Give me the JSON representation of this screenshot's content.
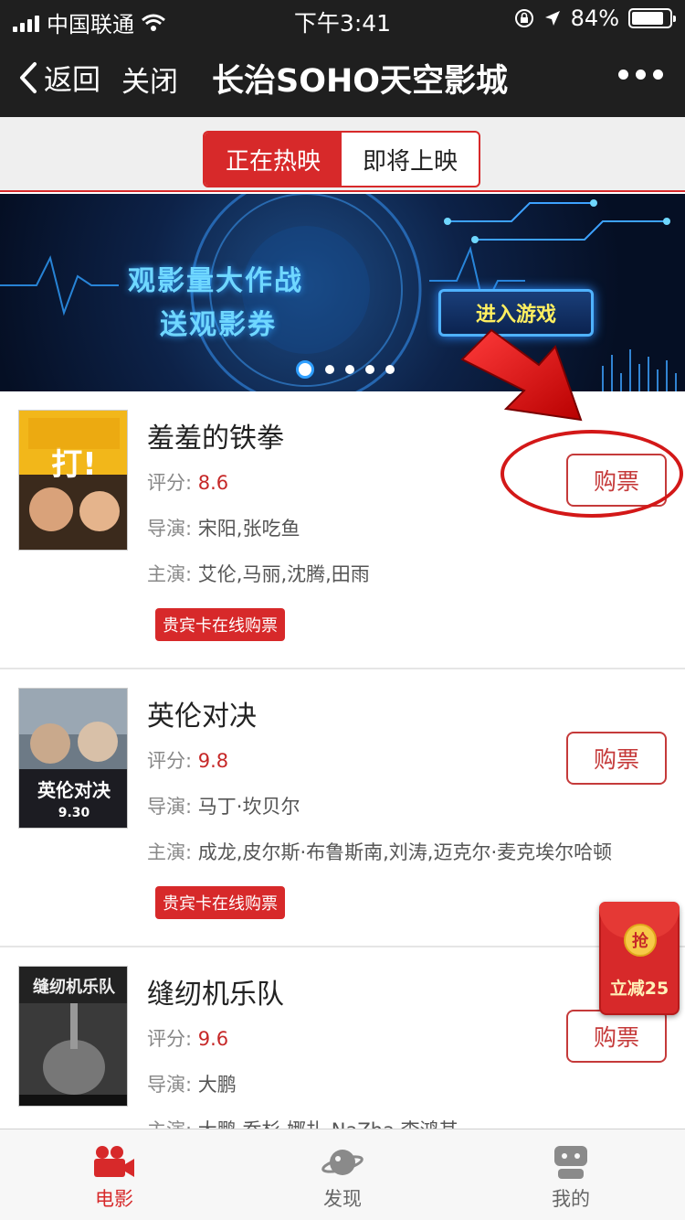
{
  "status_bar": {
    "carrier": "中国联通",
    "time": "下午3:41",
    "battery": "84%",
    "battery_level": 0.84
  },
  "nav": {
    "back_label": "返回",
    "close_label": "关闭",
    "title": "长治SOHO天空影城"
  },
  "tabs": {
    "now_showing": "正在热映",
    "coming_soon": "即将上映"
  },
  "banner": {
    "line1": "观影量大作战",
    "line2": "送观影券",
    "button": "进入游戏",
    "slide_count": 5,
    "active_slide": 1
  },
  "labels": {
    "score": "评分:",
    "director": "导演:",
    "cast": "主演:",
    "buy": "购票",
    "vip": "贵宾卡在线购票"
  },
  "movies": [
    {
      "title": "羞羞的铁拳",
      "score": "8.6",
      "director": "宋阳,张吃鱼",
      "cast": "艾伦,马丽,沈腾,田雨",
      "poster_text": "打!"
    },
    {
      "title": "英伦对决",
      "score": "9.8",
      "director": "马丁·坎贝尔",
      "cast": "成龙,皮尔斯·布鲁斯南,刘涛,迈克尔·麦克埃尔哈顿",
      "poster_text": "英伦对决",
      "poster_date": "9.30"
    },
    {
      "title": "缝纫机乐队",
      "score": "9.6",
      "director": "大鹏",
      "cast": "大鹏,乔杉,娜扎,NaZha,李鸿其",
      "poster_text": "缝纫机乐队"
    }
  ],
  "hongbao": {
    "grab": "抢",
    "discount": "立减25"
  },
  "tab_bar": {
    "movies": "电影",
    "discover": "发现",
    "mine": "我的"
  },
  "colors": {
    "brand_red": "#d7292a",
    "nav_bg": "#1f1f1f",
    "score_red": "#c62828"
  }
}
